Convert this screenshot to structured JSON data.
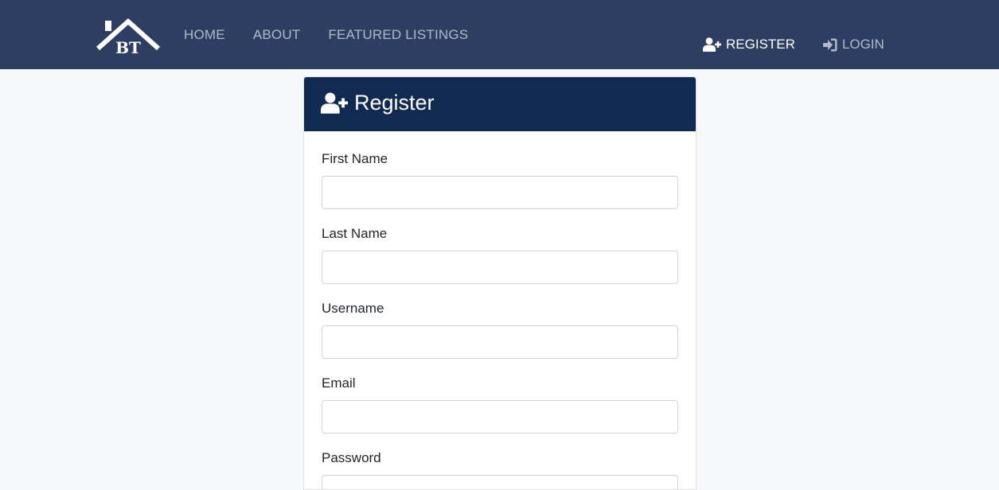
{
  "brand": {
    "logo_text": "BT",
    "icon": "house-roof-logo-icon"
  },
  "nav": {
    "left": [
      {
        "label": "HOME"
      },
      {
        "label": "ABOUT"
      },
      {
        "label": "FEATURED LISTINGS"
      }
    ],
    "register": {
      "label": "REGISTER",
      "icon": "user-plus-icon"
    },
    "login": {
      "label": "LOGIN",
      "icon": "sign-in-icon"
    }
  },
  "card": {
    "title": "Register",
    "icon": "user-plus-icon"
  },
  "form": {
    "fields": [
      {
        "label": "First Name",
        "value": "",
        "placeholder": ""
      },
      {
        "label": "Last Name",
        "value": "",
        "placeholder": ""
      },
      {
        "label": "Username",
        "value": "",
        "placeholder": ""
      },
      {
        "label": "Email",
        "value": "",
        "placeholder": ""
      },
      {
        "label": "Password",
        "value": "",
        "placeholder": ""
      }
    ]
  },
  "colors": {
    "navbar": "#2c3e62",
    "card_header": "#112a52",
    "page_background": "#f7f8fa"
  }
}
